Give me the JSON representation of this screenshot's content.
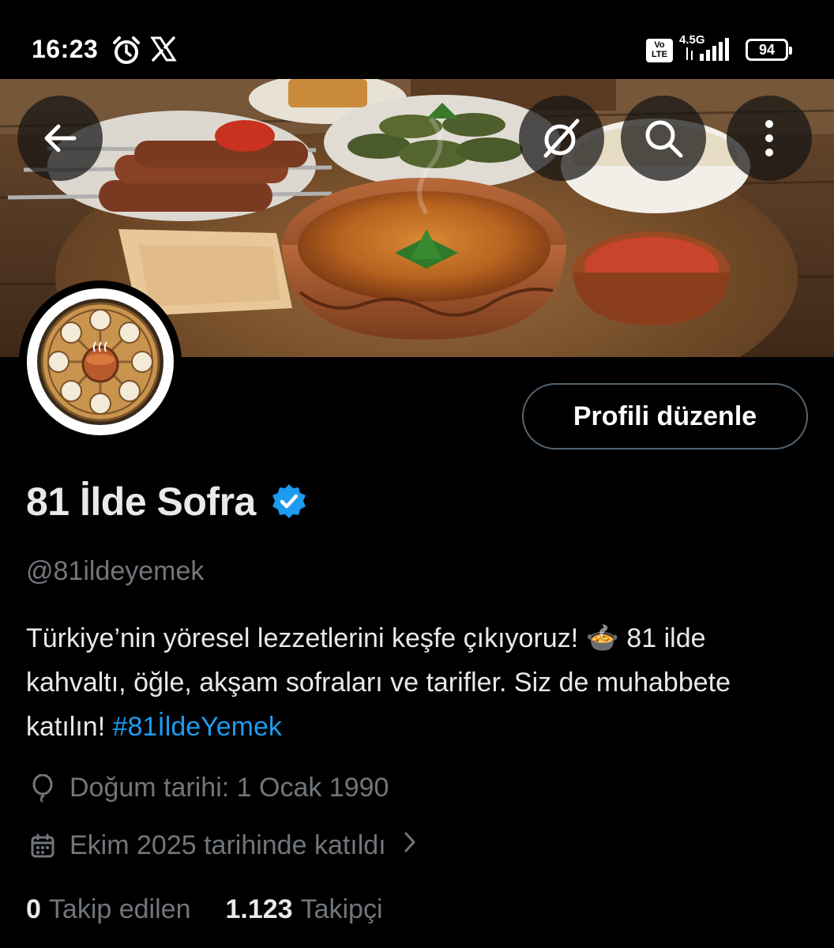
{
  "status_bar": {
    "time": "16:23",
    "network_type": "4.5G",
    "volte_label": "Vo LTE",
    "battery_level": "94",
    "icons": [
      "alarm-icon",
      "x-logo-icon",
      "volte-icon",
      "signal-icon",
      "battery-icon"
    ]
  },
  "header": {
    "icons": [
      "back-arrow-icon",
      "grok-icon",
      "search-icon",
      "more-vertical-icon"
    ]
  },
  "profile": {
    "display_name": "81 İlde Sofra",
    "handle": "@81ildeyemek",
    "verified": true,
    "edit_button_label": "Profili düzenle",
    "bio_text": "Türkiye’nin yöresel lezzetlerini keşfe çıkıyoruz! 🍲 81 ilde kahvaltı, öğle, akşam sofraları ve tarifler. Siz de muhabbete katılın! ",
    "bio_hashtag": "#81İldeYemek",
    "birth_date": "Doğum tarihi: 1 Ocak 1990",
    "joined": "Ekim 2025 tarihinde katıldı",
    "following_count": "0",
    "following_label": "Takip edilen",
    "followers_count": "1.123",
    "followers_label": "Takipçi"
  },
  "colors": {
    "background": "#000000",
    "text_primary": "#e7e9ea",
    "text_secondary": "#71767b",
    "accent": "#1d9bf0",
    "border": "#536471"
  }
}
